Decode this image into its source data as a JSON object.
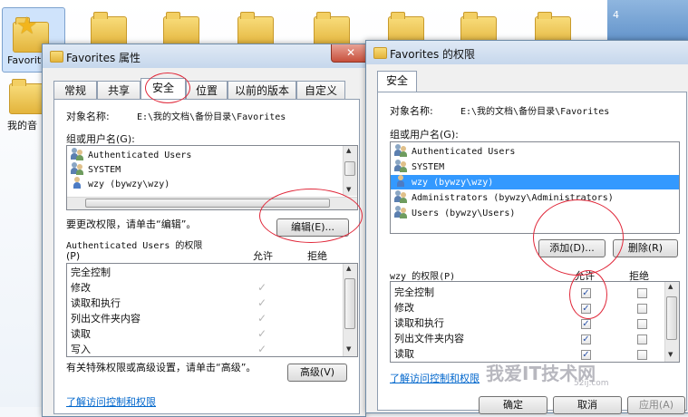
{
  "desktop": {
    "favorites_label": "Favorites",
    "music_label": "我的音",
    "badge_number": "4"
  },
  "props_dialog": {
    "title": "Favorites 属性",
    "close_label": "✕",
    "tabs": [
      "常规",
      "共享",
      "安全",
      "位置",
      "以前的版本",
      "自定义"
    ],
    "object_name_label": "对象名称:",
    "object_name_value": "E:\\我的文档\\备份目录\\Favorites",
    "group_label": "组或用户名(G):",
    "users": [
      "Authenticated Users",
      "SYSTEM",
      "wzy (bywzy\\wzy)"
    ],
    "change_hint": "要更改权限，请单击“编辑”。",
    "edit_button": "编辑(E)...",
    "perm_title": "Authenticated Users 的权限",
    "perm_sub": "(P)",
    "allow_col": "允许",
    "deny_col": "拒绝",
    "permissions": [
      "完全控制",
      "修改",
      "读取和执行",
      "列出文件夹内容",
      "读取",
      "写入"
    ],
    "allow_checked": [
      false,
      true,
      true,
      true,
      true,
      true
    ],
    "special_hint": "有关特殊权限或高级设置，请单击“高级”。",
    "advanced_button": "高级(V)",
    "link": "了解访问控制和权限"
  },
  "perm_dialog": {
    "title": "Favorites 的权限",
    "tab": "安全",
    "object_name_label": "对象名称:",
    "object_name_value": "E:\\我的文档\\备份目录\\Favorites",
    "group_label": "组或用户名(G):",
    "users": [
      {
        "name": "Authenticated Users",
        "selected": false,
        "icon": "group-user-icon"
      },
      {
        "name": "SYSTEM",
        "selected": false,
        "icon": "group-user-icon"
      },
      {
        "name": "wzy (bywzy\\wzy)",
        "selected": true,
        "icon": "single-user-icon"
      },
      {
        "name": "Administrators (bywzy\\Administrators)",
        "selected": false,
        "icon": "group-user-icon"
      },
      {
        "name": "Users (bywzy\\Users)",
        "selected": false,
        "icon": "group-user-icon"
      }
    ],
    "add_button": "添加(D)...",
    "remove_button": "删除(R)",
    "perm_title": "wzy 的权限(P)",
    "allow_col": "允许",
    "deny_col": "拒绝",
    "permissions": [
      "完全控制",
      "修改",
      "读取和执行",
      "列出文件夹内容",
      "读取"
    ],
    "allow_checked": [
      true,
      true,
      true,
      true,
      true
    ],
    "deny_checked": [
      false,
      false,
      false,
      false,
      false
    ],
    "link": "了解访问控制和权限",
    "ok_button": "确定",
    "cancel_button": "取消",
    "apply_button": "应用(A)"
  },
  "watermark": {
    "text": "我爱IT技术网",
    "sub": "52ij.com"
  },
  "colors": {
    "selection": "#3399ff",
    "link": "#0066cc",
    "annotation": "#e0283a"
  }
}
